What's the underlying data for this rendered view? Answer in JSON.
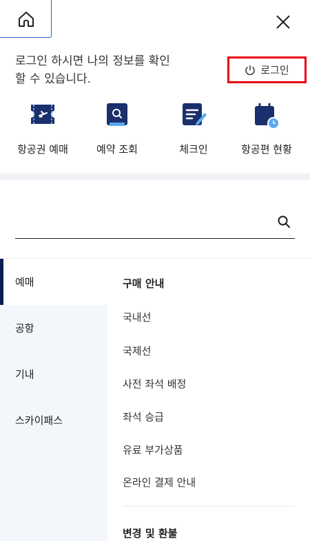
{
  "header": {
    "home_icon": "home-icon",
    "close_icon": "close-icon"
  },
  "login": {
    "message_line1": "로그인 하시면 나의 정보를 확인",
    "message_line2": "할 수 있습니다.",
    "button_label": "로그인",
    "button_icon": "power-icon",
    "highlight_color": "#e6000f"
  },
  "quick_menu": [
    {
      "label": "항공권 예매",
      "icon": "ticket-icon"
    },
    {
      "label": "예약 조회",
      "icon": "search-doc-icon"
    },
    {
      "label": "체크인",
      "icon": "checkin-icon"
    },
    {
      "label": "항공편 현황",
      "icon": "calendar-clock-icon"
    }
  ],
  "search": {
    "value": "",
    "placeholder": "",
    "icon": "search-icon"
  },
  "sidebar": {
    "items": [
      {
        "label": "예매",
        "active": true
      },
      {
        "label": "공항",
        "active": false
      },
      {
        "label": "기내",
        "active": false
      },
      {
        "label": "스카이패스",
        "active": false
      }
    ]
  },
  "menu": {
    "section1_title": "구매 안내",
    "links": [
      "국내선",
      "국제선",
      "사전 좌석 배정",
      "좌석 승급",
      "유료 부가상품",
      "온라인 결제 안내"
    ],
    "section2_title": "변경 및 환불"
  },
  "colors": {
    "brand_navy": "#0b1c52",
    "accent_blue": "#2a5ed8",
    "icon_navy": "#1a2f6b",
    "icon_light": "#5aa9f0"
  }
}
